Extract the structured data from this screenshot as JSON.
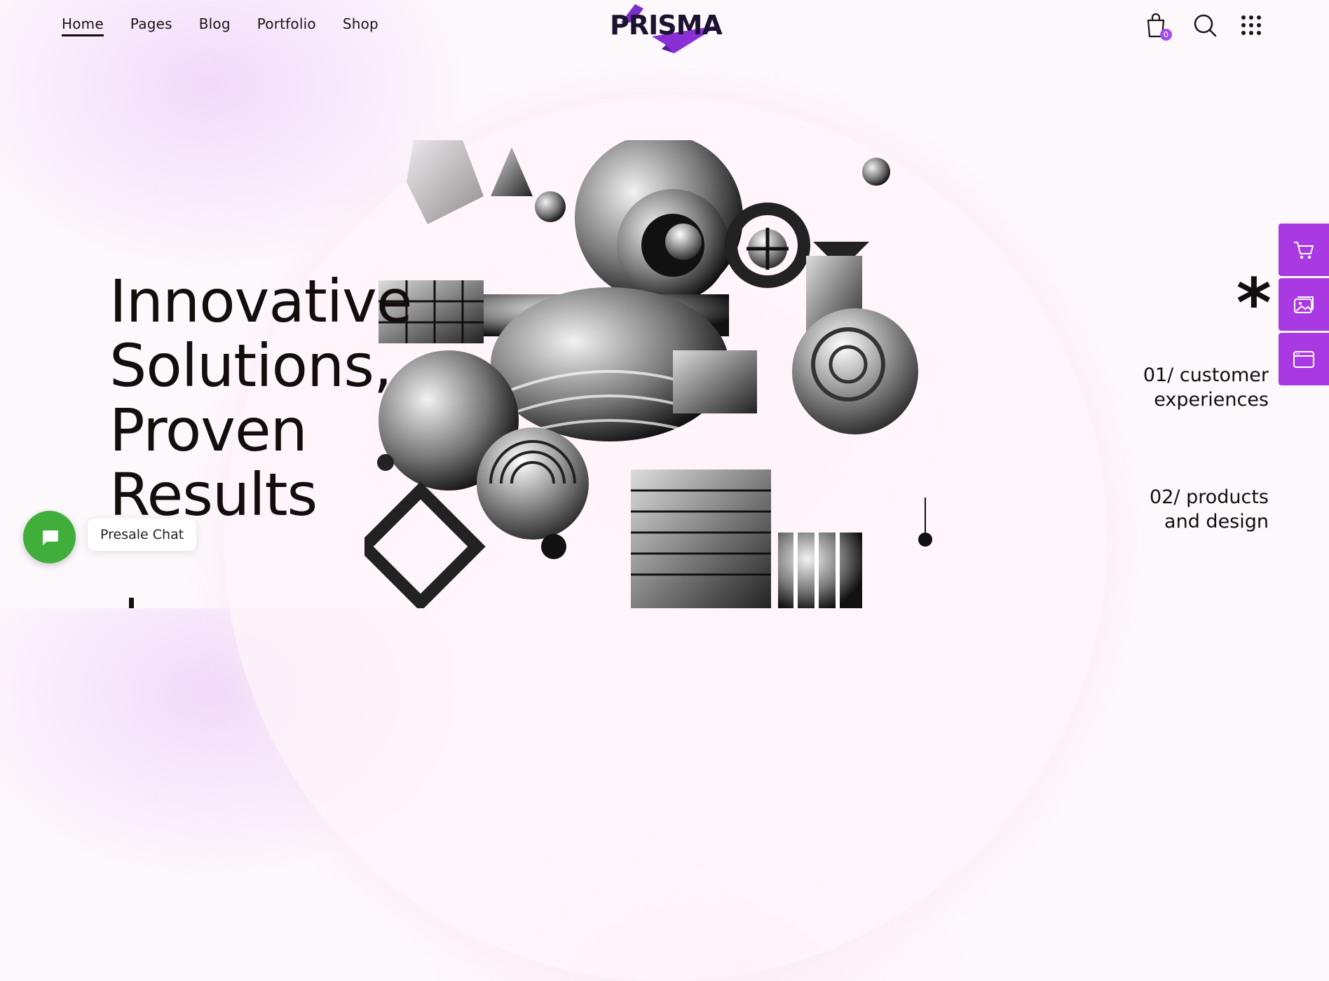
{
  "header": {
    "nav": [
      {
        "label": "Home",
        "active": true
      },
      {
        "label": "Pages"
      },
      {
        "label": "Blog"
      },
      {
        "label": "Portfolio"
      },
      {
        "label": "Shop"
      }
    ],
    "logo": "PRISMA",
    "cart_count": "0"
  },
  "hero": {
    "title_lines": [
      "Innovative",
      "Solutions,",
      "Proven",
      "Results"
    ],
    "asterisk": "*",
    "features": [
      {
        "line1": "01/ customer",
        "line2": "experiences"
      },
      {
        "line1": "02/ products",
        "line2": "and design"
      }
    ]
  },
  "side_dock": [
    "cart-icon",
    "gallery-icon",
    "browser-icon"
  ],
  "chat": {
    "label": "Presale Chat"
  },
  "colors": {
    "accent": "#a93ae3",
    "chat": "#3fae3b",
    "text": "#140d0d",
    "badge": "#a24ee8"
  }
}
